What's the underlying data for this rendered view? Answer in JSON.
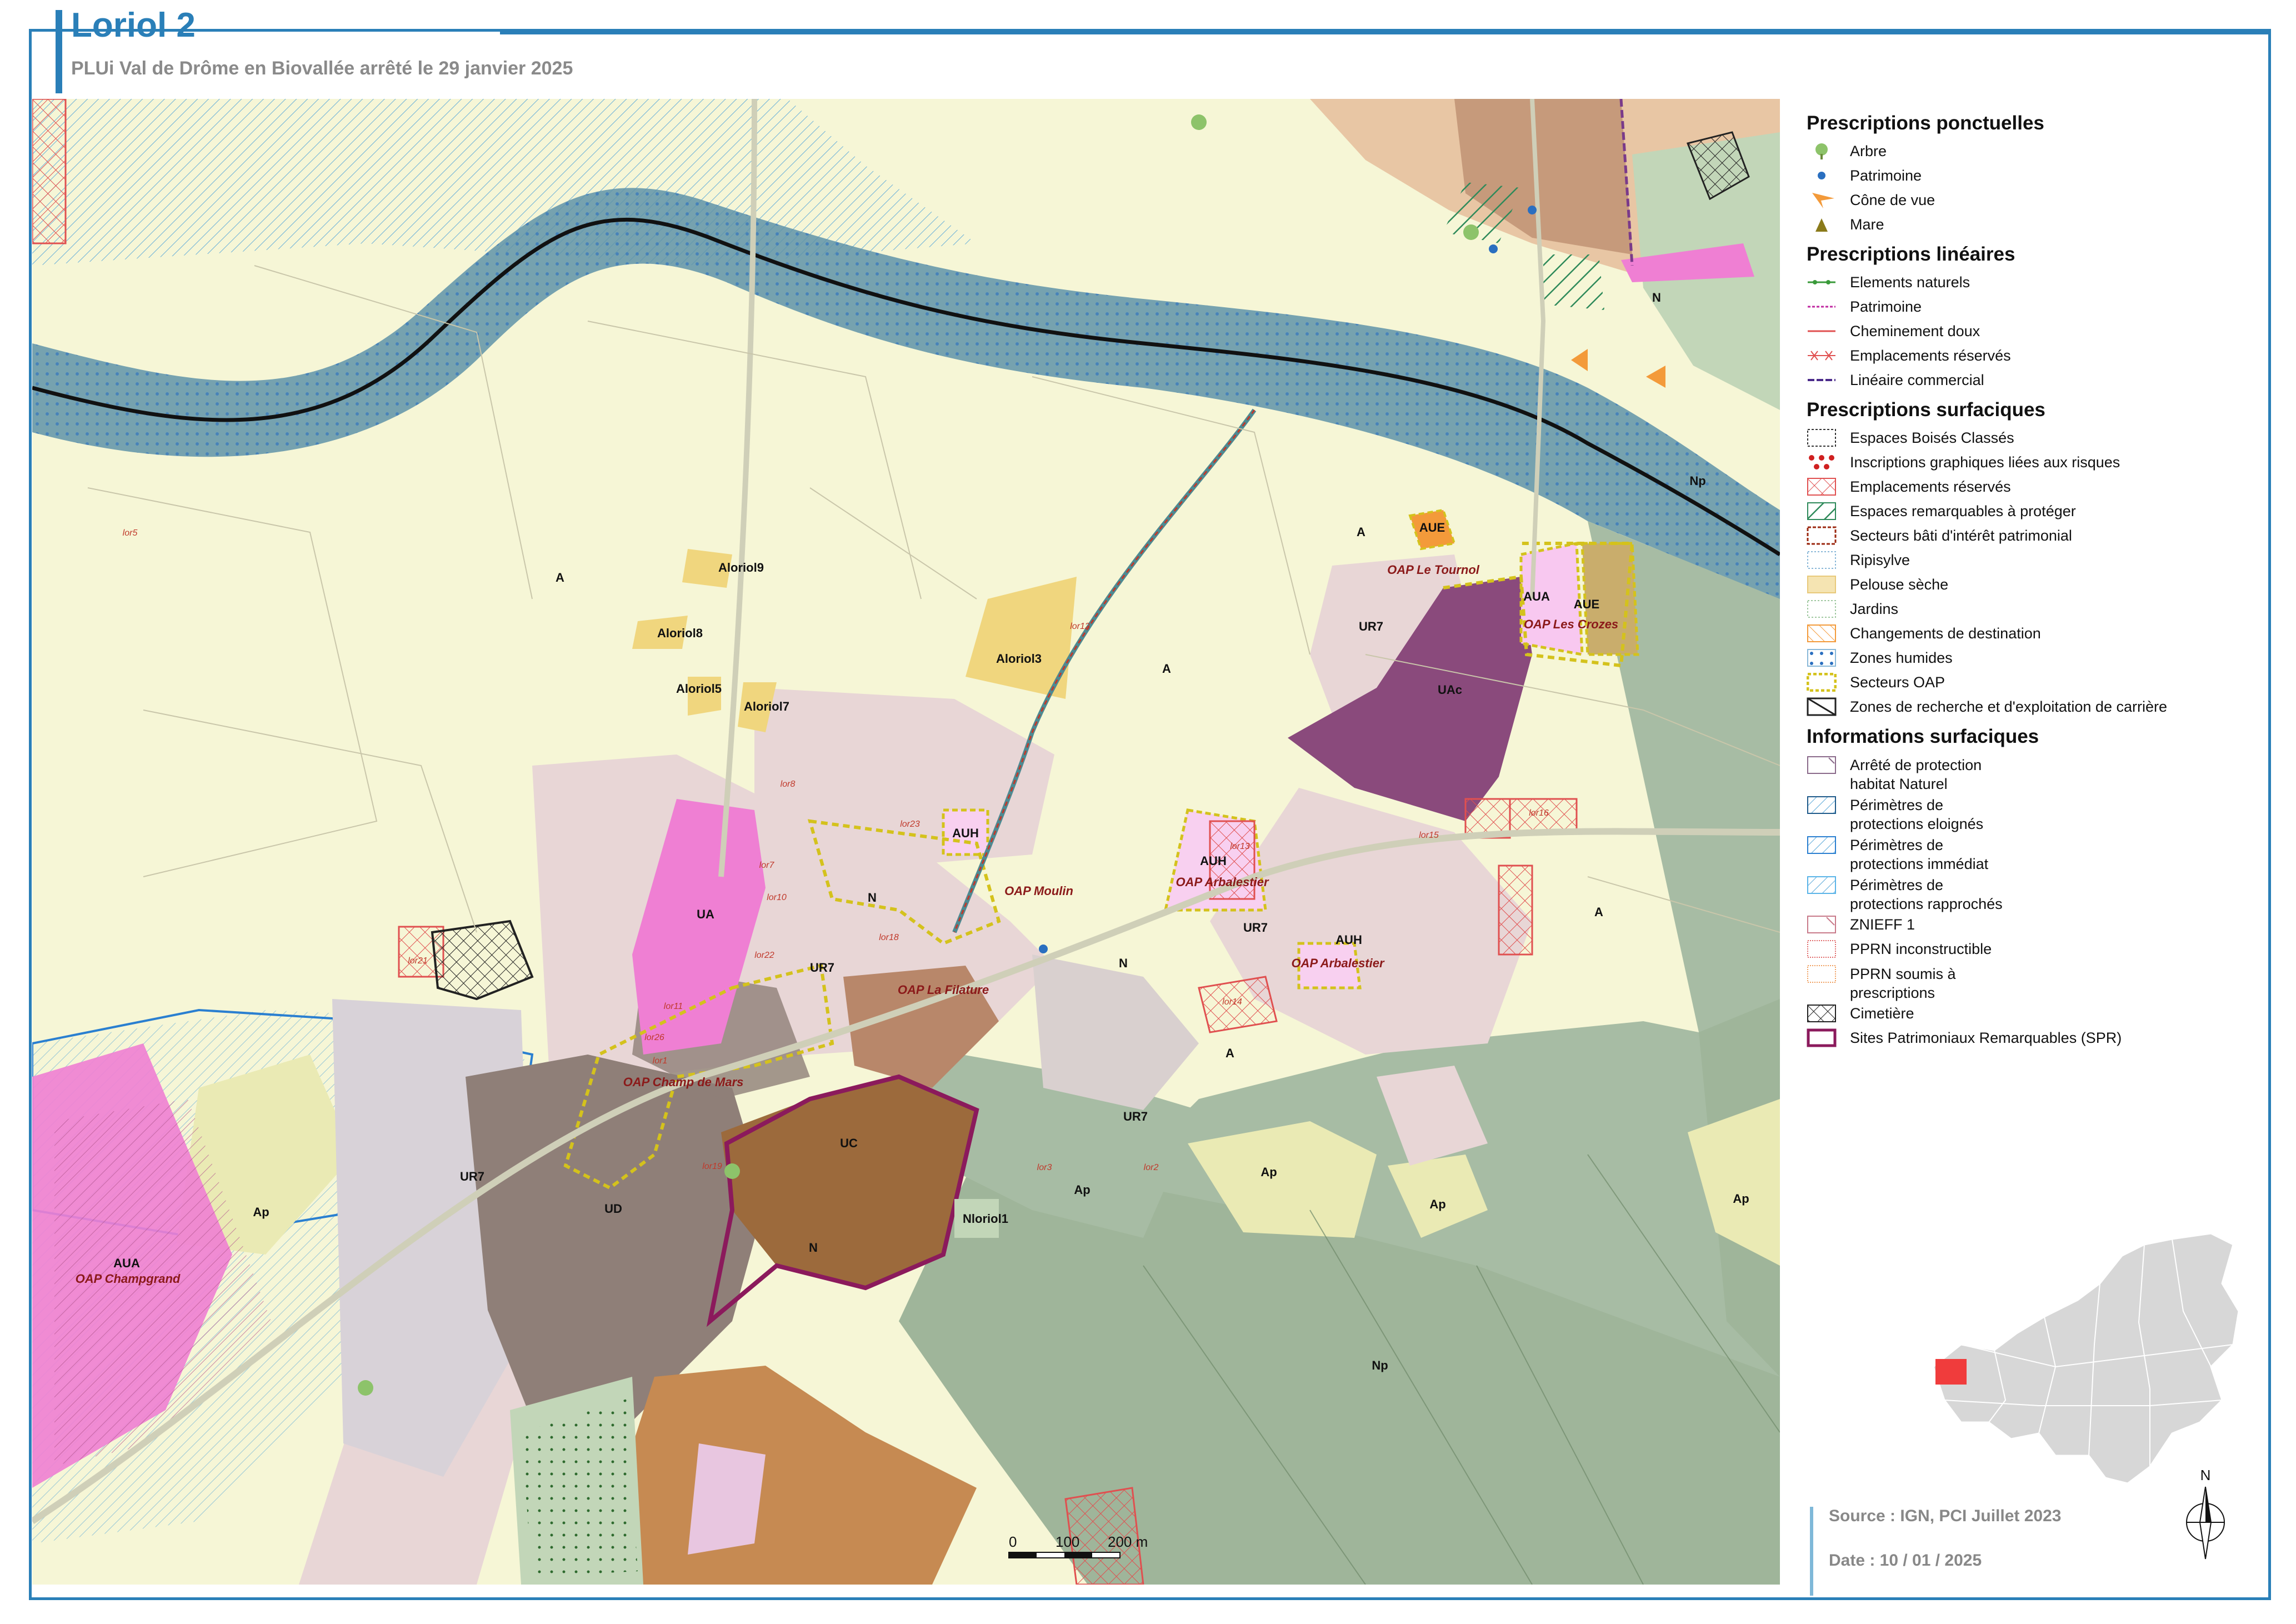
{
  "header": {
    "title": "Loriol 2",
    "subtitle": "PLUi Val de Drôme en Biovallée arrêté le 29 janvier 2025"
  },
  "colors": {
    "frame": "#2a7fb8",
    "agricultural_A": "#f6f6d6",
    "natural_N": "#9fb59a",
    "urban_UR7": "#e8d6d6",
    "urban_UD": "#8f7f78",
    "urban_UA": "#ef7fd3",
    "heritage_UC": "#9c6a3c",
    "activity_UAc": "#8a4a7c",
    "river_band": "#5f93a8"
  },
  "map": {
    "zone_labels": [
      "A",
      "A",
      "A",
      "A",
      "A",
      "N",
      "N",
      "N",
      "N",
      "Np",
      "Np",
      "Ap",
      "Ap",
      "Ap",
      "Ap",
      "Ap",
      "UR7",
      "UR7",
      "UR7",
      "UR7",
      "UR7",
      "UA",
      "UAc",
      "UC",
      "UD",
      "AUH",
      "AUH",
      "AUH",
      "AUA",
      "AUA",
      "AUE",
      "AUE",
      "Aloriol9",
      "Aloriol8",
      "Aloriol5",
      "Aloriol7",
      "Aloriol3",
      "Nloriol1"
    ],
    "oap_labels": [
      "OAP Le Tournol",
      "OAP Les Crozes",
      "OAP Moulin",
      "OAP Arbalestier",
      "OAP Arbalestier",
      "OAP La Filature",
      "OAP Champ de Mars",
      "OAP Champgrand"
    ],
    "reserved_labels": [
      "lor12",
      "lor8",
      "lor23",
      "lor7",
      "lor10",
      "lor18",
      "lor22",
      "lor11",
      "lor26",
      "lor1",
      "lor19",
      "lor21",
      "lor13",
      "lor15",
      "lor16",
      "lor14",
      "lor5",
      "lor3",
      "lor2"
    ]
  },
  "legend": {
    "ponctuelles": {
      "title": "Prescriptions ponctuelles",
      "items": [
        {
          "label": "Arbre",
          "icon": "tree-icon"
        },
        {
          "label": "Patrimoine",
          "icon": "heritage-dot-icon"
        },
        {
          "label": "Cône de vue",
          "icon": "view-cone-icon"
        },
        {
          "label": "Mare",
          "icon": "pond-triangle-icon"
        }
      ]
    },
    "lineaires": {
      "title": "Prescriptions linéaires",
      "items": [
        {
          "label": "Elements naturels"
        },
        {
          "label": "Patrimoine"
        },
        {
          "label": "Cheminement doux"
        },
        {
          "label": "Emplacements réservés"
        },
        {
          "label": "Linéaire commercial"
        }
      ]
    },
    "surfaciques": {
      "title": "Prescriptions surfaciques",
      "items": [
        {
          "label": "Espaces Boisés Classés"
        },
        {
          "label": "Inscriptions graphiques liées aux risques"
        },
        {
          "label": "Emplacements réservés"
        },
        {
          "label": "Espaces remarquables à protéger"
        },
        {
          "label": "Secteurs bâti d'intérêt patrimonial"
        },
        {
          "label": "Ripisylve"
        },
        {
          "label": "Pelouse sèche"
        },
        {
          "label": "Jardins"
        },
        {
          "label": "Changements de destination"
        },
        {
          "label": "Zones humides"
        },
        {
          "label": "Secteurs OAP"
        },
        {
          "label": "Zones de recherche et d'exploitation de carrière"
        }
      ]
    },
    "informations": {
      "title": "Informations surfaciques",
      "items": [
        {
          "label": "Arrêté de protection habitat Naturel"
        },
        {
          "label": "Périmètres de protections eloignés"
        },
        {
          "label": "Périmètres de protections immédiat"
        },
        {
          "label": "Périmètres de protections rapprochés"
        },
        {
          "label": "ZNIEFF 1"
        },
        {
          "label": "PPRN inconstructible"
        },
        {
          "label": "PPRN soumis à prescriptions"
        },
        {
          "label": "Cimetière"
        },
        {
          "label": "Sites Patrimoniaux Remarquables (SPR)"
        }
      ]
    }
  },
  "scale": {
    "ticks": [
      "0",
      "100",
      "200 m"
    ]
  },
  "north": {
    "label": "N"
  },
  "source": {
    "source_text": "Source : IGN, PCI Juillet 2023",
    "date_text": "Date : 10 / 01 / 2025"
  }
}
